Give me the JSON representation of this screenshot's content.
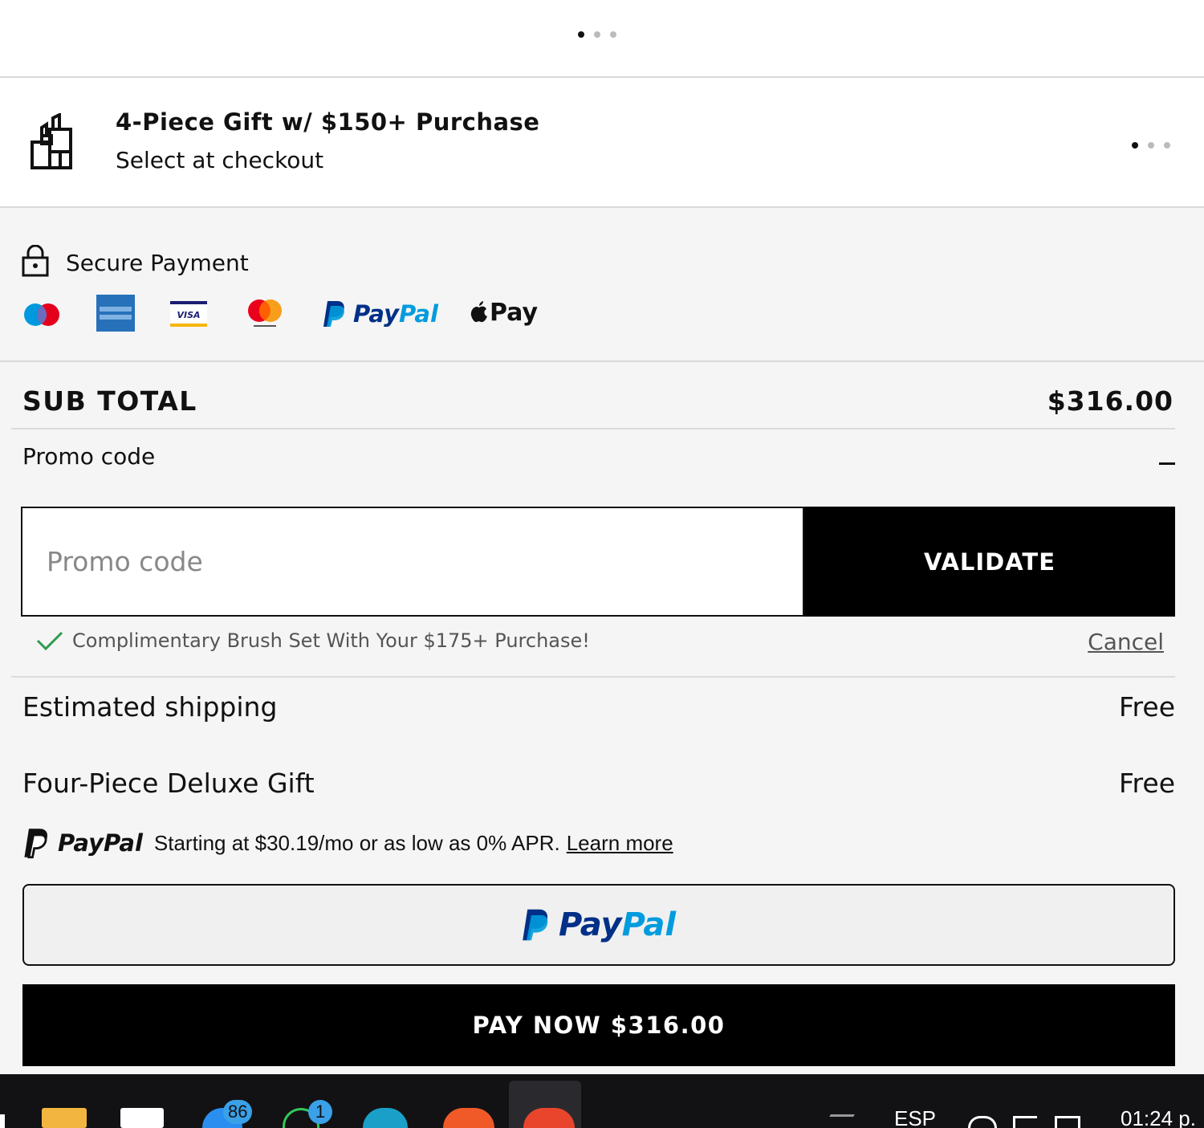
{
  "carousel": {
    "active_index": 1,
    "count": 3
  },
  "gift_banner": {
    "title": "4-Piece Gift w/ $150+ Purchase",
    "subtitle": "Select at checkout",
    "icon": "gift-products-icon"
  },
  "secure_payment": {
    "label": "Secure Payment",
    "icon": "lock-icon",
    "methods": [
      "Maestro",
      "American Express",
      "Visa",
      "Mastercard",
      "PayPal",
      "Apple Pay"
    ],
    "paypal_text": "PayPal",
    "applepay_text": "Pay"
  },
  "summary": {
    "subtotal_label": "SUB TOTAL",
    "subtotal_value": "$316.00",
    "promo_label": "Promo code",
    "promo_placeholder": "Promo code",
    "promo_value": "",
    "validate_label": "VALIDATE",
    "promo_message": "Complimentary Brush Set With Your $175+ Purchase!",
    "cancel_label": "Cancel",
    "shipping_label": "Estimated shipping",
    "shipping_value": "Free",
    "gift_label": "Four-Piece Deluxe Gift",
    "gift_value": "Free"
  },
  "paypal_credit": {
    "brand": "PayPal",
    "text": "Starting at $30.19/mo or as low as 0% APR.",
    "link": "Learn more"
  },
  "buttons": {
    "paypal_label": "PayPal",
    "pay_now_label": "PAY NOW $316.00"
  },
  "colors": {
    "paypal_dark": "#003087",
    "paypal_light": "#009cde",
    "check_green": "#2e9b4f",
    "black": "#000000"
  },
  "taskbar": {
    "badge_1": "86",
    "badge_2": "1",
    "language": "ESP",
    "time": "01:24 p."
  }
}
